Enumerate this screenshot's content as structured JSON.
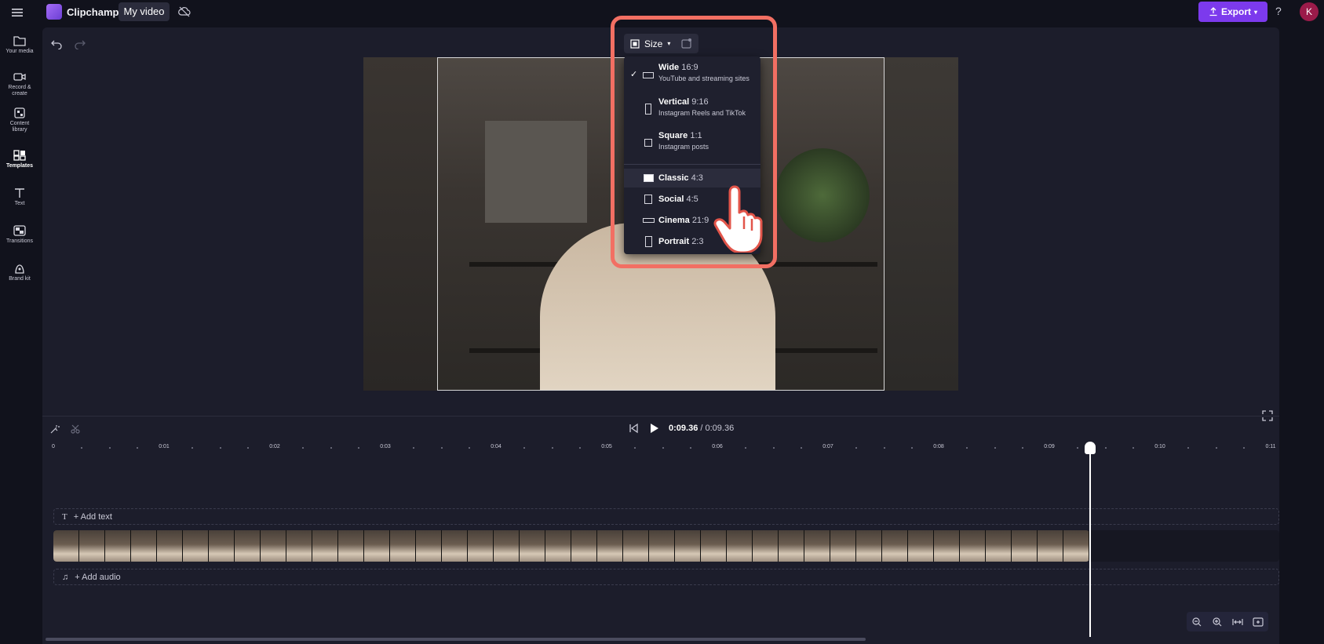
{
  "topbar": {
    "app_title": "Clipchamp",
    "project_name": "My video",
    "export_label": "Export",
    "help_label": "?",
    "avatar_initial": "K",
    "accent_color": "#7c3aed"
  },
  "leftnav": {
    "items": [
      {
        "label": "Your media",
        "icon": "folder-icon"
      },
      {
        "label": "Record & create",
        "icon": "camera-icon"
      },
      {
        "label": "Content library",
        "icon": "library-icon"
      },
      {
        "label": "Templates",
        "icon": "templates-icon",
        "active": true
      },
      {
        "label": "Text",
        "icon": "text-icon"
      },
      {
        "label": "Transitions",
        "icon": "transitions-icon"
      },
      {
        "label": "Brand kit",
        "icon": "brand-kit-icon"
      }
    ]
  },
  "preview": {
    "size_button_label": "Size"
  },
  "size_menu": {
    "options": [
      {
        "name": "Wide",
        "ratio": "16:9",
        "sub": "YouTube and streaming sites",
        "checked": true
      },
      {
        "name": "Vertical",
        "ratio": "9:16",
        "sub": "Instagram Reels and TikTok"
      },
      {
        "name": "Square",
        "ratio": "1:1",
        "sub": "Instagram posts"
      },
      {
        "name": "Classic",
        "ratio": "4:3",
        "sub": ""
      },
      {
        "name": "Social",
        "ratio": "4:5",
        "sub": ""
      },
      {
        "name": "Cinema",
        "ratio": "21:9",
        "sub": ""
      },
      {
        "name": "Portrait",
        "ratio": "2:3",
        "sub": ""
      }
    ],
    "highlight_color": "#f26f63"
  },
  "timeline": {
    "current_time": "0:09.36",
    "duration": "/ 0:09.36",
    "ruler_labels": [
      "0",
      "0:01",
      "0:02",
      "0:03",
      "0:04",
      "0:05",
      "0:06",
      "0:07",
      "0:08",
      "0:09",
      "0:10",
      "0:11"
    ],
    "add_text_label": "+ Add text",
    "add_audio_label": "+ Add audio"
  }
}
